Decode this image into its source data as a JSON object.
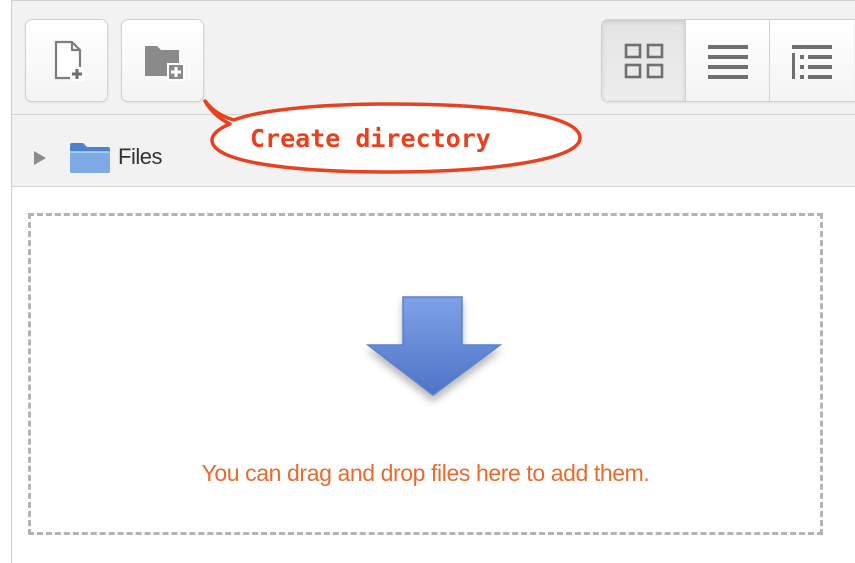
{
  "toolbar": {
    "buttons": [
      {
        "name": "add-file-button",
        "icon": "add-file-icon"
      },
      {
        "name": "create-directory-button",
        "icon": "add-folder-icon"
      }
    ],
    "views": [
      {
        "name": "view-icons-button",
        "icon": "grid-view-icon",
        "active": true
      },
      {
        "name": "view-details-button",
        "icon": "list-view-icon",
        "active": false
      },
      {
        "name": "view-tree-button",
        "icon": "tree-view-icon",
        "active": false
      }
    ]
  },
  "callout": {
    "text": "Create directory",
    "color": "#e8411f"
  },
  "path": {
    "label": "Files",
    "folder_color": "#5b8fd4"
  },
  "dropzone": {
    "message": "You can drag and drop files here to add them.",
    "message_color": "#ea6a2c",
    "arrow_color": "#5f86d4"
  }
}
